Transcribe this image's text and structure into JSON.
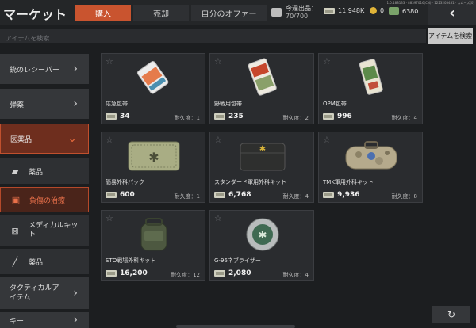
{
  "header": {
    "title": "マーケット",
    "tabs": [
      "購入",
      "売却",
      "自分のオファー"
    ],
    "weekly_label": "今週出品：",
    "weekly_value": "70/700",
    "cash": "11,948K",
    "coins": "0",
    "gc": "6380",
    "version": "1.0.188133 · 88397016(CN) · 1223203431 · スムーズ(0)"
  },
  "search": {
    "placeholder": "アイテムを検索",
    "button_label": "アイテムを検索"
  },
  "sidebar": {
    "items": [
      {
        "label": "銃のレシーバー"
      },
      {
        "label": "弾薬"
      },
      {
        "label": "医薬品"
      },
      {
        "label": "タクティカルアイテム"
      },
      {
        "label": "キー"
      }
    ],
    "sub_items": [
      {
        "label": "薬品",
        "icon": "bandage-icon"
      },
      {
        "label": "負傷の治療",
        "icon": "medkit-icon"
      },
      {
        "label": "メディカルキット",
        "icon": "first-aid-icon"
      },
      {
        "label": "薬品",
        "icon": "syringe-icon"
      }
    ]
  },
  "items": [
    {
      "name": "応急包帯",
      "price": "34",
      "durability": "耐久度：1"
    },
    {
      "name": "野戦用包帯",
      "price": "235",
      "durability": "耐久度：2"
    },
    {
      "name": "OPM包帯",
      "price": "996",
      "durability": "耐久度：4"
    },
    {
      "name": "簡易外科パック",
      "price": "600",
      "durability": "耐久度：1"
    },
    {
      "name": "スタンダード軍用外科キット",
      "price": "6,768",
      "durability": "耐久度：4"
    },
    {
      "name": "TMK軍用外科キット",
      "price": "9,936",
      "durability": "耐久度：8"
    },
    {
      "name": "STO戦場外科キット",
      "price": "16,200",
      "durability": "耐久度：12"
    },
    {
      "name": "G-96ネブライザー",
      "price": "2,080",
      "durability": "耐久度：4"
    }
  ],
  "colors": {
    "accent": "#c9542f",
    "panel": "#2a2c2f"
  }
}
